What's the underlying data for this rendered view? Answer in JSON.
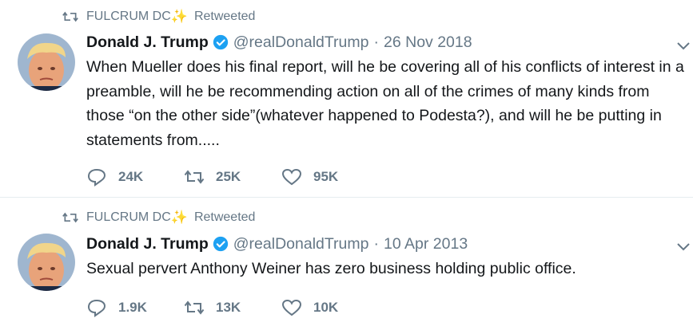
{
  "tweets": [
    {
      "retweeter": "FULCRUM DC",
      "retweeter_emoji": "✨",
      "retweet_label": "Retweeted",
      "name": "Donald J. Trump",
      "handle": "@realDonaldTrump",
      "separator": "·",
      "date": "26 Nov 2018",
      "text": "When Mueller does his final report, will he be covering all of his conflicts of interest in a preamble, will he be recommending action on all of the crimes of many kinds from those “on the other side”(whatever happened to Podesta?), and will he be putting in statements from.....",
      "replies": "24K",
      "retweets": "25K",
      "likes": "95K"
    },
    {
      "retweeter": "FULCRUM DC",
      "retweeter_emoji": "✨",
      "retweet_label": "Retweeted",
      "name": "Donald J. Trump",
      "handle": "@realDonaldTrump",
      "separator": "·",
      "date": "10 Apr 2013",
      "text": "Sexual pervert Anthony Weiner has zero business holding public office.",
      "replies": "1.9K",
      "retweets": "13K",
      "likes": "10K"
    }
  ],
  "colors": {
    "text": "#14171a",
    "secondary": "#657786",
    "verified": "#1da1f2",
    "divider": "#e6ecf0",
    "sparkle": "#f5b400"
  },
  "icons": {
    "retweeted": "retweet-icon",
    "verified": "verified-badge-icon",
    "menu": "chevron-down-icon",
    "reply": "reply-icon",
    "retweet": "retweet-icon",
    "like": "heart-icon"
  }
}
